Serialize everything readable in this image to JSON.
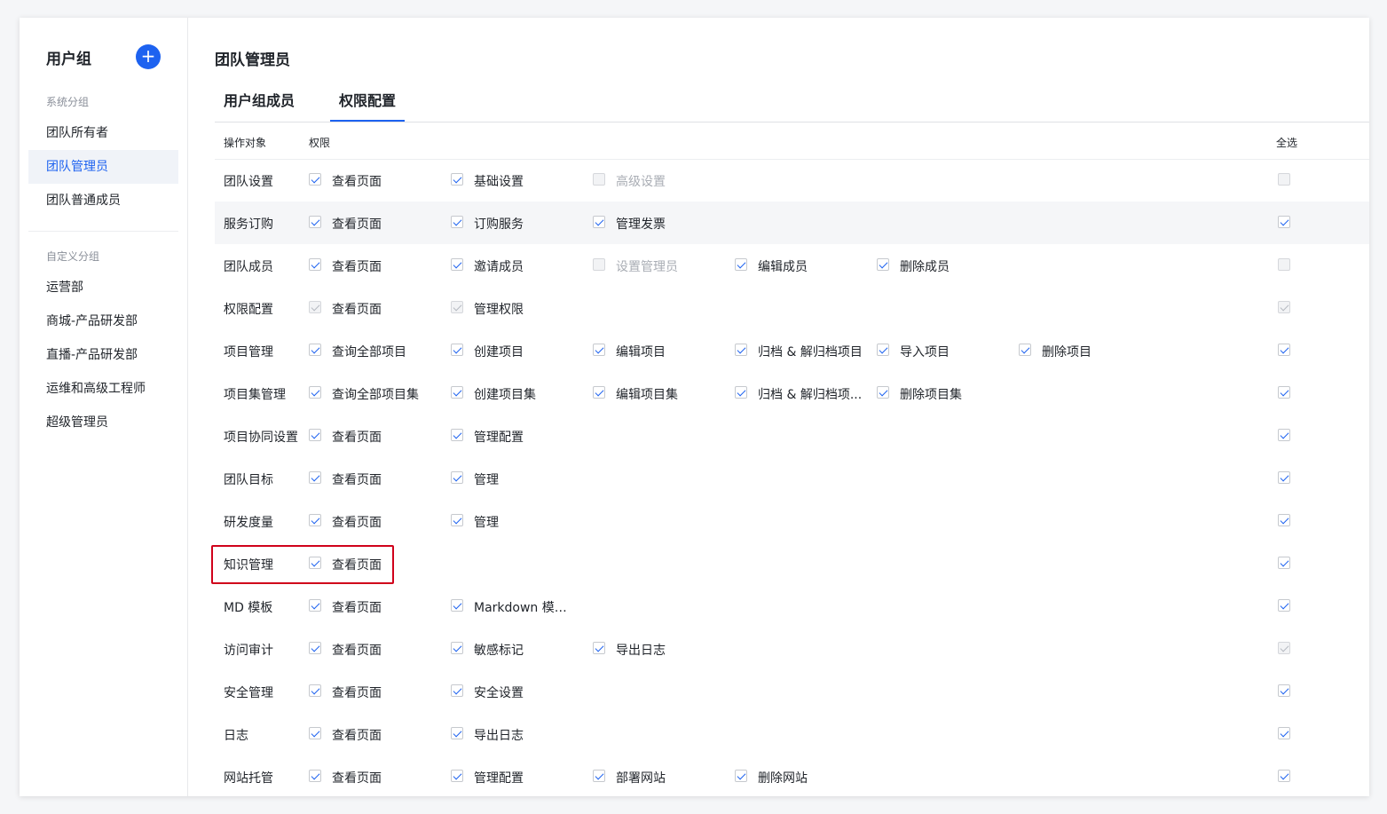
{
  "sidebar": {
    "title": "用户组",
    "add_icon": "plus-icon",
    "system_section": "系统分组",
    "system_items": [
      "团队所有者",
      "团队管理员",
      "团队普通成员"
    ],
    "custom_section": "自定义分组",
    "custom_items": [
      "运营部",
      "商城-产品研发部",
      "直播-产品研发部",
      "运维和高级工程师",
      "超级管理员"
    ],
    "active_item": "团队管理员"
  },
  "main": {
    "title": "团队管理员",
    "tabs": [
      "用户组成员",
      "权限配置"
    ],
    "active_tab": "权限配置",
    "table": {
      "col_object": "操作对象",
      "col_perm": "权限",
      "col_all": "全选",
      "rows": [
        {
          "name": "团队设置",
          "perms": [
            {
              "label": "查看页面",
              "checked": true,
              "disabled": false
            },
            {
              "label": "基础设置",
              "checked": true,
              "disabled": false
            },
            {
              "label": "高级设置",
              "checked": false,
              "disabled": true
            }
          ],
          "all": {
            "checked": false,
            "disabled": true
          }
        },
        {
          "name": "服务订购",
          "perms": [
            {
              "label": "查看页面",
              "checked": true,
              "disabled": false
            },
            {
              "label": "订购服务",
              "checked": true,
              "disabled": false
            },
            {
              "label": "管理发票",
              "checked": true,
              "disabled": false
            }
          ],
          "all": {
            "checked": true,
            "disabled": false
          }
        },
        {
          "name": "团队成员",
          "perms": [
            {
              "label": "查看页面",
              "checked": true,
              "disabled": false
            },
            {
              "label": "邀请成员",
              "checked": true,
              "disabled": false
            },
            {
              "label": "设置管理员",
              "checked": false,
              "disabled": true
            },
            {
              "label": "编辑成员",
              "checked": true,
              "disabled": false
            },
            {
              "label": "删除成员",
              "checked": true,
              "disabled": false
            }
          ],
          "all": {
            "checked": false,
            "disabled": true
          }
        },
        {
          "name": "权限配置",
          "perms": [
            {
              "label": "查看页面",
              "checked": true,
              "disabled": true
            },
            {
              "label": "管理权限",
              "checked": true,
              "disabled": true
            }
          ],
          "all": {
            "checked": true,
            "disabled": true
          }
        },
        {
          "name": "项目管理",
          "perms": [
            {
              "label": "查询全部项目",
              "checked": true,
              "disabled": false
            },
            {
              "label": "创建项目",
              "checked": true,
              "disabled": false
            },
            {
              "label": "编辑项目",
              "checked": true,
              "disabled": false
            },
            {
              "label": "归档 & 解归档项目",
              "checked": true,
              "disabled": false
            },
            {
              "label": "导入项目",
              "checked": true,
              "disabled": false
            },
            {
              "label": "删除项目",
              "checked": true,
              "disabled": false
            }
          ],
          "all": {
            "checked": true,
            "disabled": false
          }
        },
        {
          "name": "项目集管理",
          "perms": [
            {
              "label": "查询全部项目集",
              "checked": true,
              "disabled": false
            },
            {
              "label": "创建项目集",
              "checked": true,
              "disabled": false
            },
            {
              "label": "编辑项目集",
              "checked": true,
              "disabled": false
            },
            {
              "label": "归档 & 解归档项...",
              "checked": true,
              "disabled": false
            },
            {
              "label": "删除项目集",
              "checked": true,
              "disabled": false
            }
          ],
          "all": {
            "checked": true,
            "disabled": false
          }
        },
        {
          "name": "项目协同设置",
          "perms": [
            {
              "label": "查看页面",
              "checked": true,
              "disabled": false
            },
            {
              "label": "管理配置",
              "checked": true,
              "disabled": false
            }
          ],
          "all": {
            "checked": true,
            "disabled": false
          }
        },
        {
          "name": "团队目标",
          "perms": [
            {
              "label": "查看页面",
              "checked": true,
              "disabled": false
            },
            {
              "label": "管理",
              "checked": true,
              "disabled": false
            }
          ],
          "all": {
            "checked": true,
            "disabled": false
          }
        },
        {
          "name": "研发度量",
          "perms": [
            {
              "label": "查看页面",
              "checked": true,
              "disabled": false
            },
            {
              "label": "管理",
              "checked": true,
              "disabled": false
            }
          ],
          "all": {
            "checked": true,
            "disabled": false
          }
        },
        {
          "name": "知识管理",
          "perms": [
            {
              "label": "查看页面",
              "checked": true,
              "disabled": false
            }
          ],
          "all": {
            "checked": true,
            "disabled": false
          }
        },
        {
          "name": "MD 模板",
          "perms": [
            {
              "label": "查看页面",
              "checked": true,
              "disabled": false
            },
            {
              "label": "Markdown 模板...",
              "checked": true,
              "disabled": false
            }
          ],
          "all": {
            "checked": true,
            "disabled": false
          }
        },
        {
          "name": "访问审计",
          "perms": [
            {
              "label": "查看页面",
              "checked": true,
              "disabled": false
            },
            {
              "label": "敏感标记",
              "checked": true,
              "disabled": false
            },
            {
              "label": "导出日志",
              "checked": true,
              "disabled": false
            }
          ],
          "all": {
            "checked": true,
            "disabled": true
          }
        },
        {
          "name": "安全管理",
          "perms": [
            {
              "label": "查看页面",
              "checked": true,
              "disabled": false
            },
            {
              "label": "安全设置",
              "checked": true,
              "disabled": false
            }
          ],
          "all": {
            "checked": true,
            "disabled": false
          }
        },
        {
          "name": "日志",
          "perms": [
            {
              "label": "查看页面",
              "checked": true,
              "disabled": false
            },
            {
              "label": "导出日志",
              "checked": true,
              "disabled": false
            }
          ],
          "all": {
            "checked": true,
            "disabled": false
          }
        },
        {
          "name": "网站托管",
          "perms": [
            {
              "label": "查看页面",
              "checked": true,
              "disabled": false
            },
            {
              "label": "管理配置",
              "checked": true,
              "disabled": false
            },
            {
              "label": "部署网站",
              "checked": true,
              "disabled": false
            },
            {
              "label": "删除网站",
              "checked": true,
              "disabled": false
            }
          ],
          "all": {
            "checked": true,
            "disabled": false
          }
        }
      ]
    }
  },
  "colors": {
    "accent": "#1d62f0",
    "highlight_border": "#d0021b",
    "row_highlight": "#f5f6f8"
  },
  "highlighted_row": "知识管理",
  "hovered_row": "服务订购"
}
